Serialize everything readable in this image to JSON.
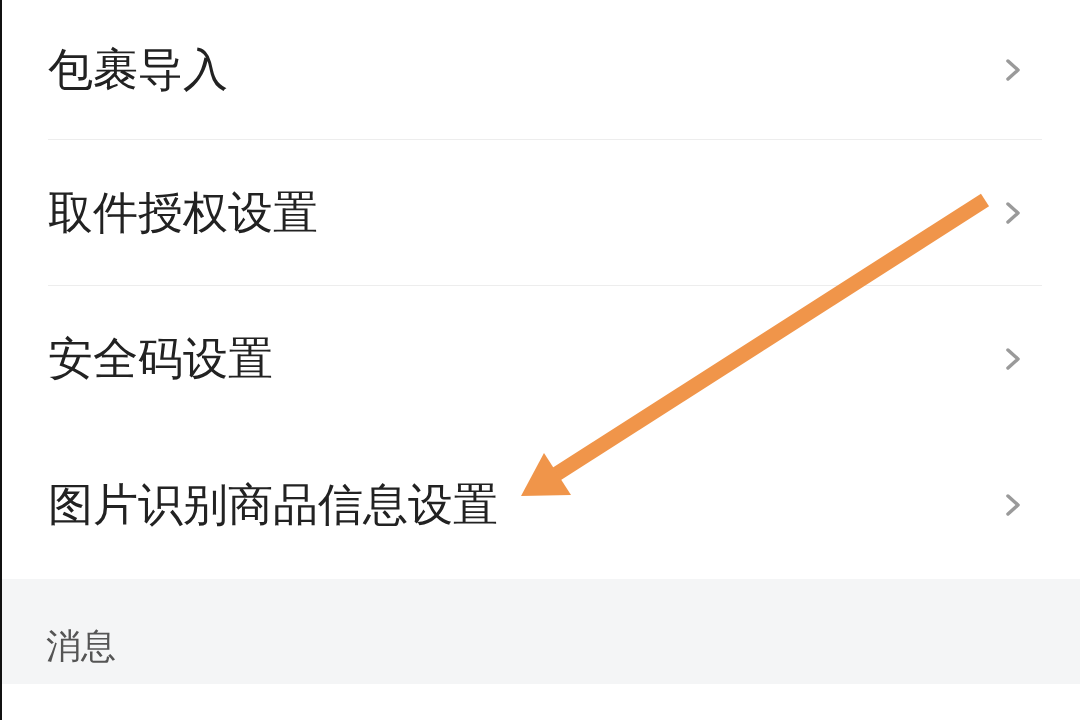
{
  "settings_items": [
    {
      "label": "包裹导入",
      "separator": true
    },
    {
      "label": "取件授权设置",
      "separator": true
    },
    {
      "label": "安全码设置",
      "separator": false
    },
    {
      "label": "图片识别商品信息设置",
      "separator": false
    }
  ],
  "section_header": {
    "label": "消息"
  }
}
